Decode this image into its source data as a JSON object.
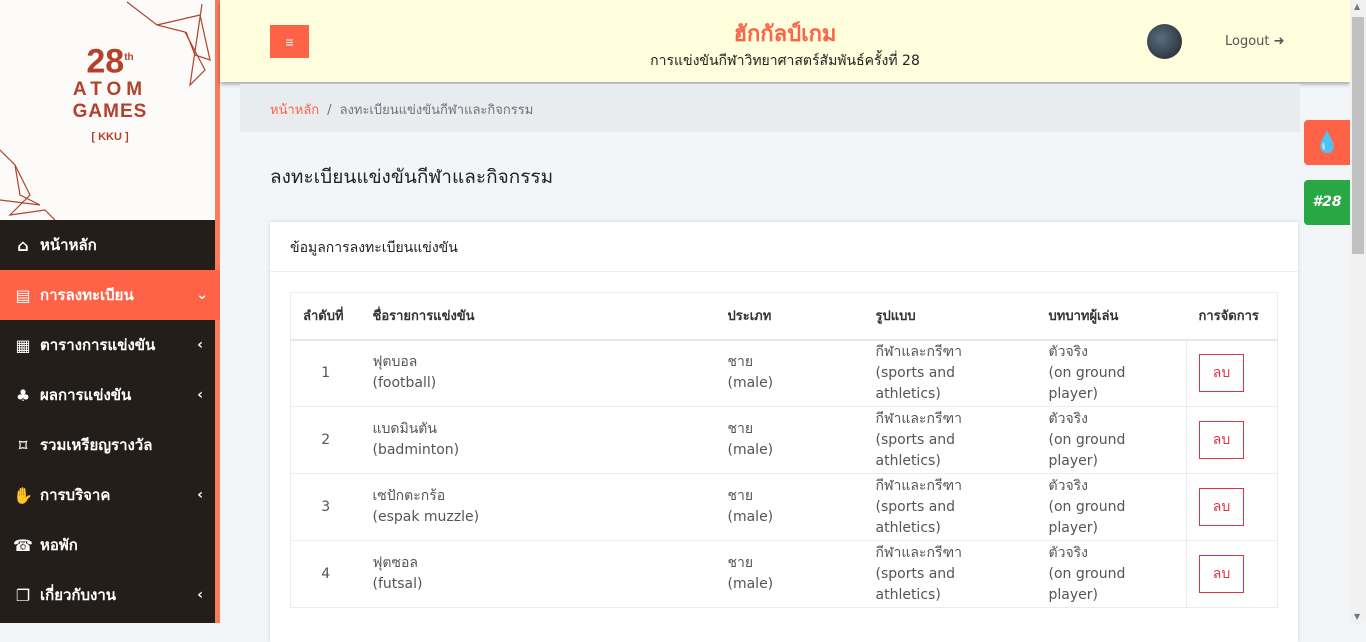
{
  "logo": {
    "text": "28th ATOM GAMES [KKU]"
  },
  "sidebar": {
    "items": [
      {
        "label": "หน้าหลัก",
        "icon": "home-icon",
        "glyph": "⌂",
        "chevron": ""
      },
      {
        "label": "การลงทะเบียน",
        "icon": "clipboard-icon",
        "glyph": "▤",
        "chevron": "⌄"
      },
      {
        "label": "ตารางการแข่งขัน",
        "icon": "table-icon",
        "glyph": "▦",
        "chevron": "‹"
      },
      {
        "label": "ผลการแข่งขัน",
        "icon": "sitemap-icon",
        "glyph": "♣",
        "chevron": "‹"
      },
      {
        "label": "รวมเหรียญรางวัล",
        "icon": "bookmark-icon",
        "glyph": "⌑",
        "chevron": ""
      },
      {
        "label": "การบริจาค",
        "icon": "handshake-icon",
        "glyph": "✋",
        "chevron": "‹"
      },
      {
        "label": "หอพัก",
        "icon": "phone-icon",
        "glyph": "☎",
        "chevron": ""
      },
      {
        "label": "เกี่ยวกับงาน",
        "icon": "window-icon",
        "glyph": "❐",
        "chevron": "‹"
      }
    ]
  },
  "header": {
    "menu_glyph": "≡",
    "title": "ฮักกัลป์เกม",
    "subtitle": "การแข่งขันกีฬาวิทยาศาสตร์สัมพันธ์ครั้งที่ 28",
    "logout": "Logout ➜"
  },
  "breadcrumb": {
    "home": "หน้าหลัก",
    "sep": "/",
    "current": "ลงทะเบียนแข่งขันกีฬาและกิจกรรม"
  },
  "page_title": "ลงทะเบียนแข่งขันกีฬาและกิจกรรม",
  "floating": {
    "drop": "💧",
    "badge": "#28"
  },
  "card": {
    "title": "ข้อมูลการลงทะเบียนแข่งขัน",
    "columns": [
      "ลำดับที่",
      "ชื่อรายการแข่งขัน",
      "ประเภท",
      "รูปแบบ",
      "บทบาทผู้เล่น",
      "การจัดการ"
    ],
    "rows": [
      {
        "no": "1",
        "name": "ฟุตบอล",
        "name_en": "(football)",
        "type": "ชาย",
        "type_en": "(male)",
        "format": "กีฬาและกรีฑา",
        "format_en": "(sports and athletics)",
        "role": "ตัวจริง",
        "role_en": "(on ground player)",
        "action": "ลบ"
      },
      {
        "no": "2",
        "name": "แบดมินตัน",
        "name_en": "(badminton)",
        "type": "ชาย",
        "type_en": "(male)",
        "format": "กีฬาและกรีฑา",
        "format_en": "(sports and athletics)",
        "role": "ตัวจริง",
        "role_en": "(on ground player)",
        "action": "ลบ"
      },
      {
        "no": "3",
        "name": "เซปักตะกร้อ",
        "name_en": "(espak muzzle)",
        "type": "ชาย",
        "type_en": "(male)",
        "format": "กีฬาและกรีฑา",
        "format_en": "(sports and athletics)",
        "role": "ตัวจริง",
        "role_en": "(on ground player)",
        "action": "ลบ"
      },
      {
        "no": "4",
        "name": "ฟุตซอล",
        "name_en": "(futsal)",
        "type": "ชาย",
        "type_en": "(male)",
        "format": "กีฬาและกรีฑา",
        "format_en": "(sports and athletics)",
        "role": "ตัวจริง",
        "role_en": "(on ground player)",
        "action": "ลบ"
      }
    ]
  }
}
